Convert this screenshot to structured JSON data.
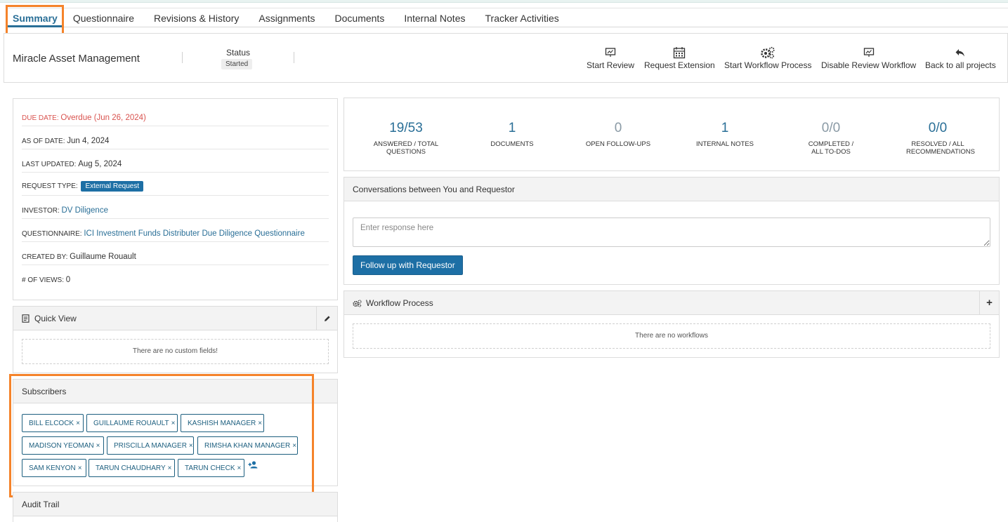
{
  "tabs": [
    {
      "label": "Summary",
      "active": true
    },
    {
      "label": "Questionnaire"
    },
    {
      "label": "Revisions & History"
    },
    {
      "label": "Assignments"
    },
    {
      "label": "Documents"
    },
    {
      "label": "Internal Notes"
    },
    {
      "label": "Tracker Activities"
    }
  ],
  "header": {
    "title": "Miracle Asset Management",
    "status_label": "Status",
    "status_value": "Started",
    "actions": {
      "start_review": "Start Review",
      "request_extension": "Request Extension",
      "start_workflow": "Start Workflow Process",
      "disable_review": "Disable Review Workflow",
      "back": "Back to all projects"
    }
  },
  "info": {
    "due_date": {
      "key": "DUE DATE:",
      "value": "Overdue (Jun 26, 2024)"
    },
    "as_of_date": {
      "key": "AS OF DATE:",
      "value": "Jun 4, 2024"
    },
    "last_updated": {
      "key": "LAST UPDATED:",
      "value": "Aug 5, 2024"
    },
    "request_type": {
      "key": "REQUEST TYPE:",
      "value": "External Request"
    },
    "investor": {
      "key": "INVESTOR:",
      "value": "DV Diligence"
    },
    "questionnaire": {
      "key": "QUESTIONNAIRE:",
      "value": "ICI Investment Funds Distributer Due Diligence Questionnaire"
    },
    "created_by": {
      "key": "CREATED BY:",
      "value": "Guillaume Rouault"
    },
    "views": {
      "key": "# OF VIEWS:",
      "value": "0"
    }
  },
  "quick_view": {
    "title": "Quick View",
    "empty": "There are no custom fields!"
  },
  "subscribers": {
    "title": "Subscribers",
    "items": [
      "BILL ELCOCK",
      "GUILLAUME ROUAULT",
      "KASHISH MANAGER",
      "MADISON YEOMAN",
      "PRISCILLA MANAGER",
      "RIMSHA KHAN MANAGER",
      "SAM KENYON",
      "TARUN CHAUDHARY",
      "TARUN CHECK"
    ],
    "remove_glyph": "×"
  },
  "audit_trail": {
    "title": "Audit Trail"
  },
  "stats": [
    {
      "value": "19/53",
      "label": "ANSWERED / TOTAL QUESTIONS"
    },
    {
      "value": "1",
      "label": "DOCUMENTS"
    },
    {
      "value": "0",
      "label": "OPEN FOLLOW-UPS"
    },
    {
      "value": "1",
      "label": "INTERNAL NOTES"
    },
    {
      "value": "0/0",
      "label": "COMPLETED / ALL TO-DOS"
    },
    {
      "value": "0/0",
      "label": "RESOLVED / ALL RECOMMENDATIONS"
    }
  ],
  "conversation": {
    "title": "Conversations between You and Requestor",
    "placeholder": "Enter response here",
    "button": "Follow up with Requestor"
  },
  "workflow": {
    "title": "Workflow Process",
    "add_glyph": "+",
    "empty": "There are no workflows"
  },
  "colors": {
    "accent": "#2a6f97",
    "primary_button": "#1d6fa5",
    "overdue": "#d9534f",
    "highlight": "#f5832a"
  }
}
